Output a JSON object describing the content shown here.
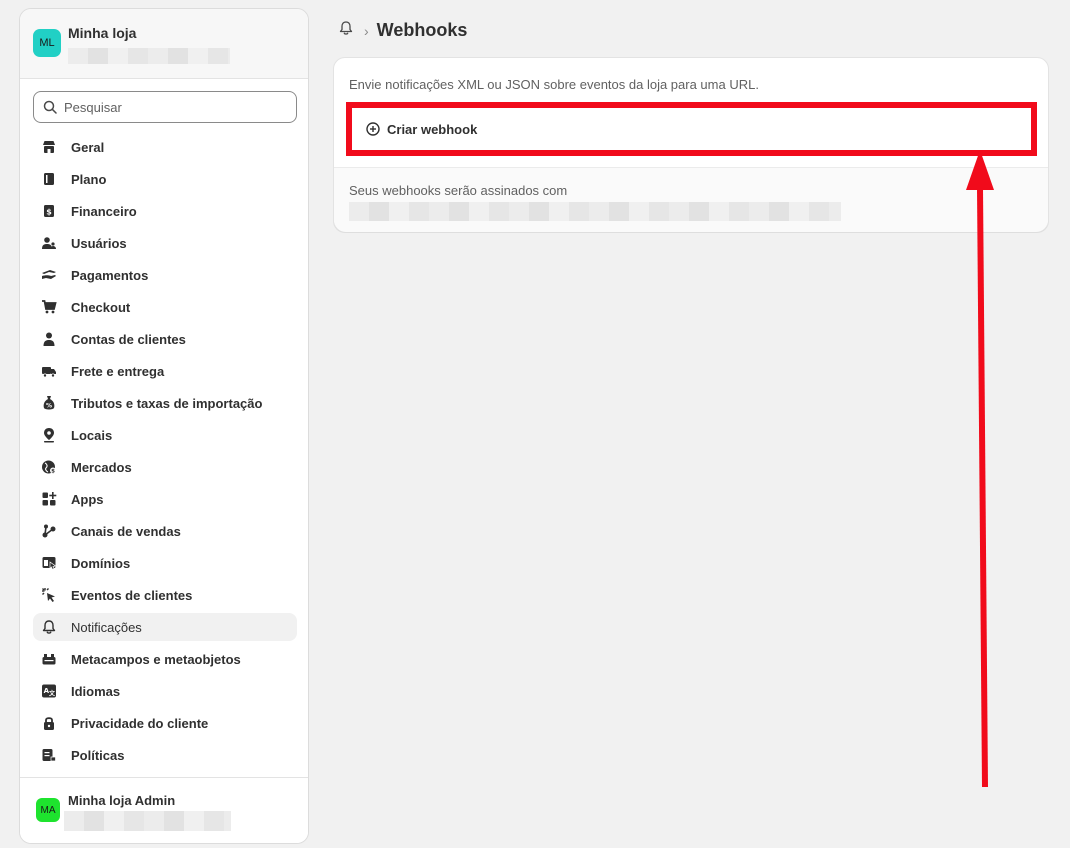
{
  "store": {
    "avatar": "ML",
    "name": "Minha loja"
  },
  "search": {
    "placeholder": "Pesquisar"
  },
  "nav": [
    {
      "label": "Geral",
      "icon": "store-icon"
    },
    {
      "label": "Plano",
      "icon": "plan-icon"
    },
    {
      "label": "Financeiro",
      "icon": "billing-icon"
    },
    {
      "label": "Usuários",
      "icon": "users-icon"
    },
    {
      "label": "Pagamentos",
      "icon": "payments-icon"
    },
    {
      "label": "Checkout",
      "icon": "cart-icon"
    },
    {
      "label": "Contas de clientes",
      "icon": "person-icon"
    },
    {
      "label": "Frete e entrega",
      "icon": "truck-icon"
    },
    {
      "label": "Tributos e taxas de importação",
      "icon": "tax-bag-icon"
    },
    {
      "label": "Locais",
      "icon": "location-pin-icon"
    },
    {
      "label": "Mercados",
      "icon": "globe-icon"
    },
    {
      "label": "Apps",
      "icon": "apps-grid-icon"
    },
    {
      "label": "Canais de vendas",
      "icon": "channels-icon"
    },
    {
      "label": "Domínios",
      "icon": "domains-icon"
    },
    {
      "label": "Eventos de clientes",
      "icon": "cursor-click-icon"
    },
    {
      "label": "Notificações",
      "icon": "bell-icon",
      "active": true
    },
    {
      "label": "Metacampos e metaobjetos",
      "icon": "metafields-icon"
    },
    {
      "label": "Idiomas",
      "icon": "translate-icon"
    },
    {
      "label": "Privacidade do cliente",
      "icon": "lock-icon"
    },
    {
      "label": "Políticas",
      "icon": "policies-icon"
    }
  ],
  "admin": {
    "avatar": "MA",
    "name": "Minha loja Admin"
  },
  "page": {
    "title": "Webhooks",
    "breadcrumb_icon": "bell-icon"
  },
  "card": {
    "description": "Envie notificações XML ou JSON sobre eventos da loja para uma URL.",
    "create_button": "Criar webhook",
    "signed_label": "Seus webhooks serão assinados com"
  },
  "colors": {
    "highlight": "#f10b1b",
    "store_avatar": "#21d0c5",
    "admin_avatar": "#1ee32e"
  }
}
